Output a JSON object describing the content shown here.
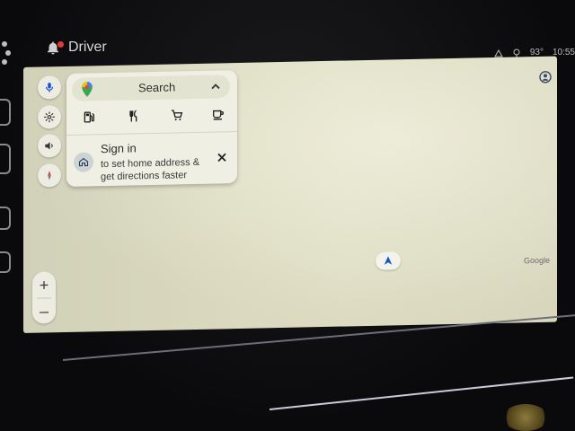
{
  "topbar": {
    "profile_label": "Driver",
    "temperature": "93°",
    "time": "10:55"
  },
  "search_panel": {
    "search_label": "Search",
    "categories": [
      {
        "name": "gas-station-icon"
      },
      {
        "name": "restaurant-icon"
      },
      {
        "name": "grocery-cart-icon"
      },
      {
        "name": "coffee-icon"
      }
    ],
    "signin": {
      "title": "Sign in",
      "subtitle": "to set home address & get directions faster"
    }
  },
  "map": {
    "attribution": "Google"
  },
  "zoom": {
    "in_label": "+",
    "out_label": "–"
  },
  "colors": {
    "screen_bg": "#e6e5c9",
    "panel_bg": "#efefe3",
    "accent_blue": "#1a4fd6",
    "notification_red": "#e53935"
  }
}
